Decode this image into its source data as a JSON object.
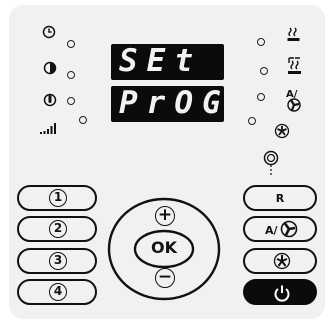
{
  "display": {
    "line1": "SEt",
    "line2": "PrOG"
  },
  "icons_left": [
    "clock-icon",
    "pie-timer-icon",
    "thermometer-icon",
    "signal-bars-icon"
  ],
  "icons_right": [
    "heat-waves-icon",
    "programme-heat-icon",
    "auto-fan-icon",
    "fan-icon"
  ],
  "indicator": "status-lamp-icon",
  "buttons": {
    "program_1": "1",
    "program_2": "2",
    "program_3": "3",
    "program_4": "4",
    "plus": "+",
    "ok": "OK",
    "minus": "−",
    "reset": "R",
    "auto_fan": "A/",
    "fan_speed": "fan",
    "power": "power"
  },
  "colors": {
    "panel": "#f1f1f1",
    "display_bg": "#0b0b0b",
    "segment": "#f2f2f2",
    "power_button": "#0b0b0b"
  }
}
